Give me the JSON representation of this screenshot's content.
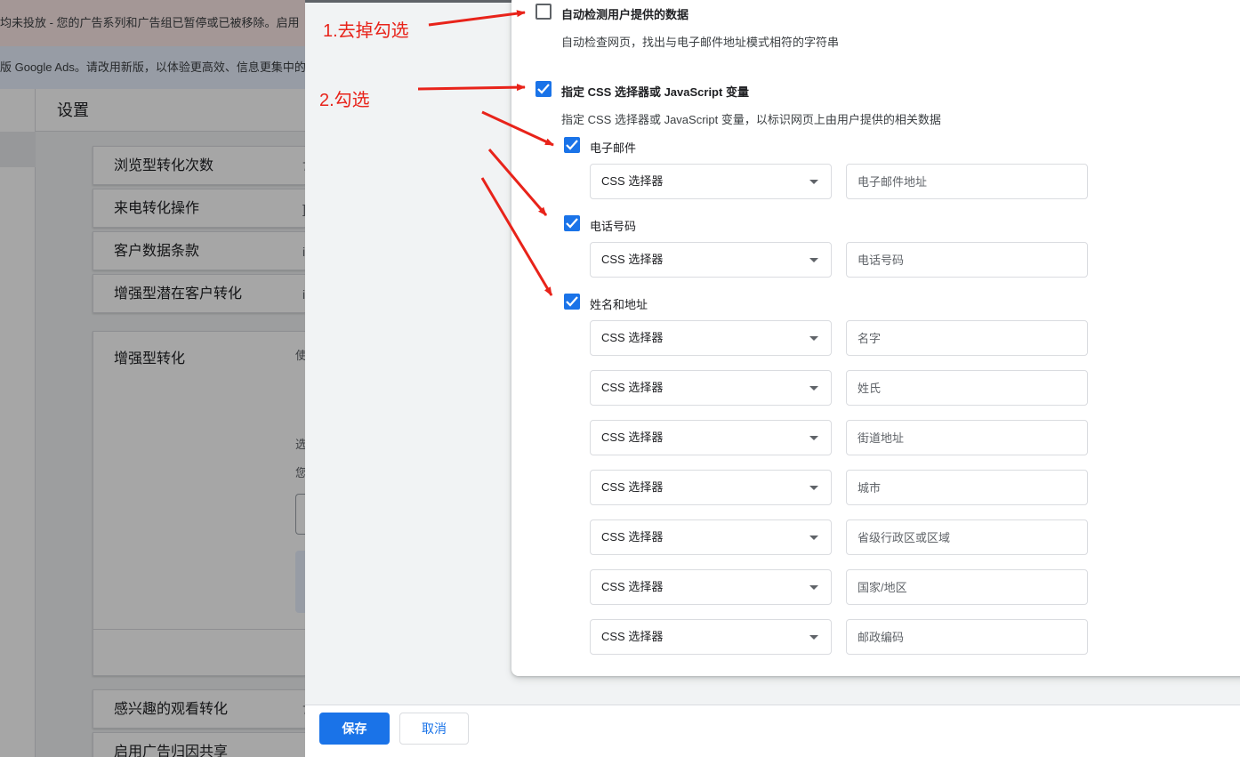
{
  "background": {
    "banner_error": "均未投放 - 您的广告系列和广告组已暂停或已被移除。启用",
    "banner_info": "版 Google Ads。请改用新版，以体验更高效、信息更集中的",
    "header_title": "设置",
    "rows": [
      {
        "label": "浏览型转化次数",
        "trail": "7"
      },
      {
        "label": "来电转化操作",
        "trail": "]"
      },
      {
        "label": "客户数据条款",
        "trail": "i"
      },
      {
        "label": "增强型潜在客户转化",
        "trail": "i"
      }
    ],
    "enhanced_title": "增强型转化",
    "enhanced_fragments": [
      "使",
      "选",
      "您"
    ],
    "bottom_rows": [
      {
        "label": "感兴趣的观看转化",
        "trail": "7"
      },
      {
        "label": "启用广告归因共享"
      }
    ]
  },
  "form": {
    "auto_detect": {
      "label": "自动检测用户提供的数据",
      "description": "自动检查网页，找出与电子邮件地址模式相符的字符串",
      "checked": false
    },
    "specify": {
      "label": "指定 CSS 选择器或 JavaScript 变量",
      "description": "指定 CSS 选择器或 JavaScript 变量，以标识网页上由用户提供的相关数据",
      "checked": true
    },
    "email": {
      "label": "电子邮件",
      "checked": true,
      "select": "CSS 选择器",
      "placeholder": "电子邮件地址"
    },
    "phone": {
      "label": "电话号码",
      "checked": true,
      "select": "CSS 选择器",
      "placeholder": "电话号码"
    },
    "name_address": {
      "label": "姓名和地址",
      "checked": true,
      "fields": [
        {
          "select": "CSS 选择器",
          "placeholder": "名字"
        },
        {
          "select": "CSS 选择器",
          "placeholder": "姓氏"
        },
        {
          "select": "CSS 选择器",
          "placeholder": "街道地址"
        },
        {
          "select": "CSS 选择器",
          "placeholder": "城市"
        },
        {
          "select": "CSS 选择器",
          "placeholder": "省级行政区或区域"
        },
        {
          "select": "CSS 选择器",
          "placeholder": "国家/地区"
        },
        {
          "select": "CSS 选择器",
          "placeholder": "邮政编码"
        }
      ]
    }
  },
  "footer": {
    "save": "保存",
    "cancel": "取消"
  },
  "annotations": {
    "step1": "1.去掉勾选",
    "step2": "2.勾选",
    "color": "#e8231a"
  },
  "colors": {
    "accent": "#1a73e8",
    "panel_bg": "#f1f3f4",
    "annotation": "#e8231a"
  }
}
